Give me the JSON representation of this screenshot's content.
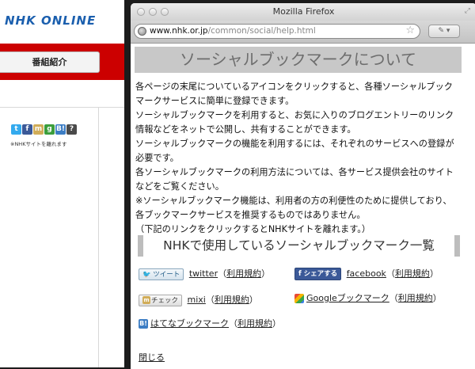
{
  "background_page": {
    "logo_text": "NHK ONLINE",
    "nav_tab_label": "番組紹介",
    "share_icons": [
      {
        "icon": "twitter-icon",
        "glyph": "t",
        "color": "#33aaee"
      },
      {
        "icon": "facebook-icon",
        "glyph": "f",
        "color": "#3b5998"
      },
      {
        "icon": "mixi-icon",
        "glyph": "m",
        "color": "#d1ad59"
      },
      {
        "icon": "google-bookmark-icon",
        "glyph": "g",
        "color": "#3c9e3c"
      },
      {
        "icon": "hatena-icon",
        "glyph": "B!",
        "color": "#3c7dc4"
      },
      {
        "icon": "help-icon",
        "glyph": "?",
        "color": "#4a4a4a"
      }
    ],
    "share_note": "※NHKサイトを離れます"
  },
  "window": {
    "title": "Mozilla Firefox",
    "url_domain": "www.nhk.or.jp",
    "url_path": "/common/social/help.html",
    "ext_button_label": "✎ ▾"
  },
  "content": {
    "heading": "ソーシャルブックマークについて",
    "lines": [
      "各ページの末尾についているアイコンをクリックすると、各種ソーシャルブック",
      "マークサービスに簡単に登録できます。",
      "ソーシャルブックマークを利用すると、お気に入りのブログエントリーのリンク",
      "情報などをネットで公開し、共有することができます。",
      "ソーシャルブックマークの機能を利用するには、それぞれのサービスへの登録が",
      "必要です。",
      "各ソーシャルブックマークの利用方法については、各サービス提供会社のサイト",
      "などをご覧ください。",
      "※ソーシャルブックマーク機能は、利用者の方の利便性のために提供しており、",
      "各ブックマークサービスを推奨するものではありません。",
      "（下記のリンクをクリックするとNHKサイトを離れます。）"
    ],
    "subheading": "NHKで使用しているソーシャルブックマーク一覧",
    "services": {
      "twitter": {
        "badge": "ツイート",
        "name": "twitter",
        "terms": "利用規約"
      },
      "facebook": {
        "badge": "シェアする",
        "name": "facebook",
        "terms": "利用規約"
      },
      "mixi": {
        "badge": "チェック",
        "name": "mixi",
        "terms": "利用規約"
      },
      "google": {
        "name": "Googleブックマーク",
        "terms": "利用規約"
      },
      "hatena": {
        "name": "はてなブックマーク",
        "terms": "利用規約"
      }
    },
    "close_label": "閉じる"
  }
}
